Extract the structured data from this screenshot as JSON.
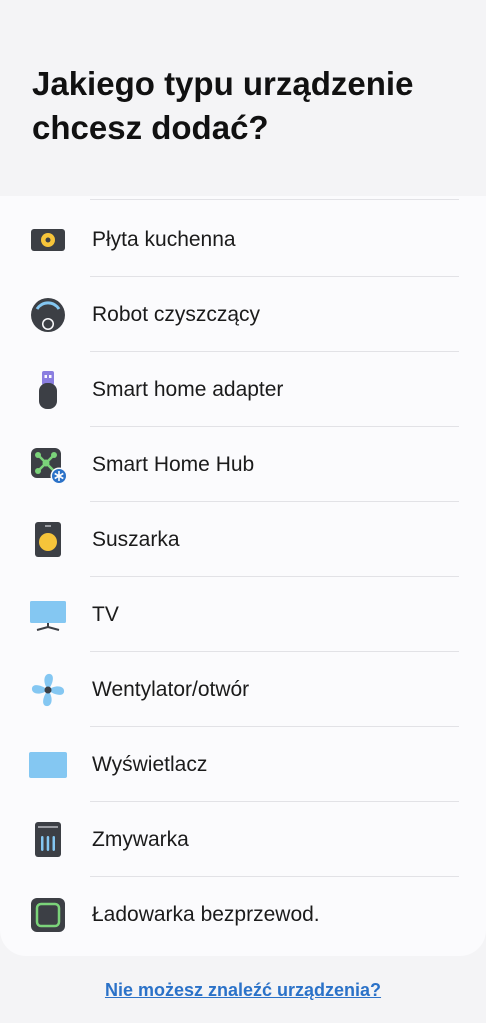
{
  "header": {
    "title": "Jakiego typu urządzenie chcesz dodać?"
  },
  "devices": [
    {
      "label": "Płyta kuchenna",
      "icon": "cooktop-icon"
    },
    {
      "label": "Robot czyszczący",
      "icon": "robot-vacuum-icon"
    },
    {
      "label": "Smart home adapter",
      "icon": "usb-adapter-icon"
    },
    {
      "label": "Smart Home Hub",
      "icon": "hub-icon"
    },
    {
      "label": "Suszarka",
      "icon": "dryer-icon"
    },
    {
      "label": "TV",
      "icon": "tv-icon"
    },
    {
      "label": "Wentylator/otwór",
      "icon": "fan-icon"
    },
    {
      "label": "Wyświetlacz",
      "icon": "display-icon"
    },
    {
      "label": "Zmywarka",
      "icon": "dishwasher-icon"
    },
    {
      "label": "Ładowarka bezprzewod.",
      "icon": "wireless-charger-icon"
    }
  ],
  "footer": {
    "link": "Nie możesz znaleźć urządzenia?"
  },
  "colors": {
    "accent": "#2b72c8",
    "icon_dark": "#3c3f45",
    "icon_yellow": "#f6c43a",
    "icon_blue": "#84c7f2"
  }
}
